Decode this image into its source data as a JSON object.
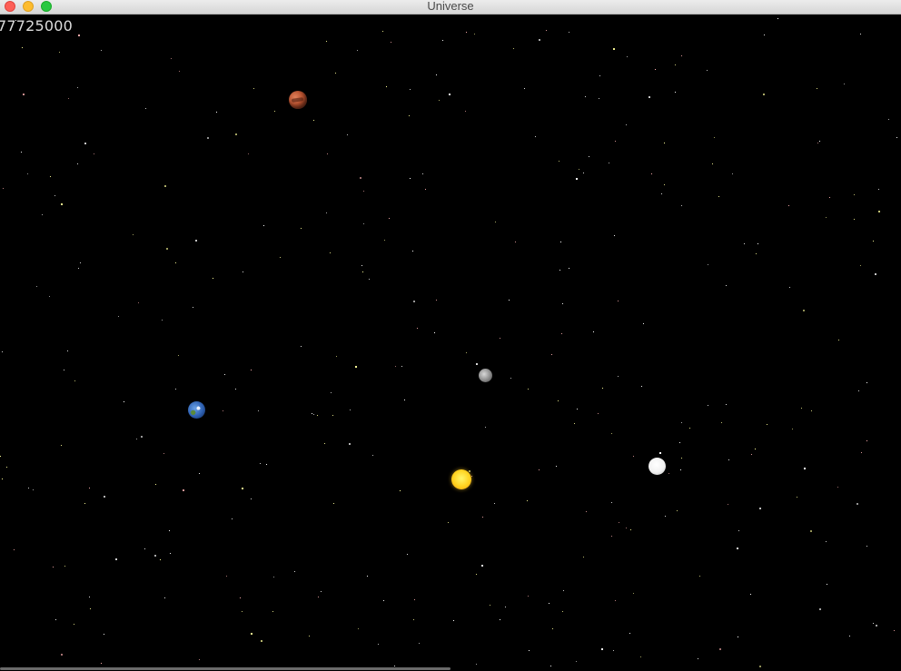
{
  "window": {
    "title": "Universe"
  },
  "canvas": {
    "counter": "77725000",
    "background": "#000000"
  },
  "bodies": [
    {
      "name": "mars"
    },
    {
      "name": "moon"
    },
    {
      "name": "earth"
    },
    {
      "name": "sun"
    },
    {
      "name": "white-planet"
    }
  ],
  "colors": {
    "star": "#ffffff",
    "star_yellow": "#ffff99",
    "star_pink": "#ffb0b0"
  }
}
